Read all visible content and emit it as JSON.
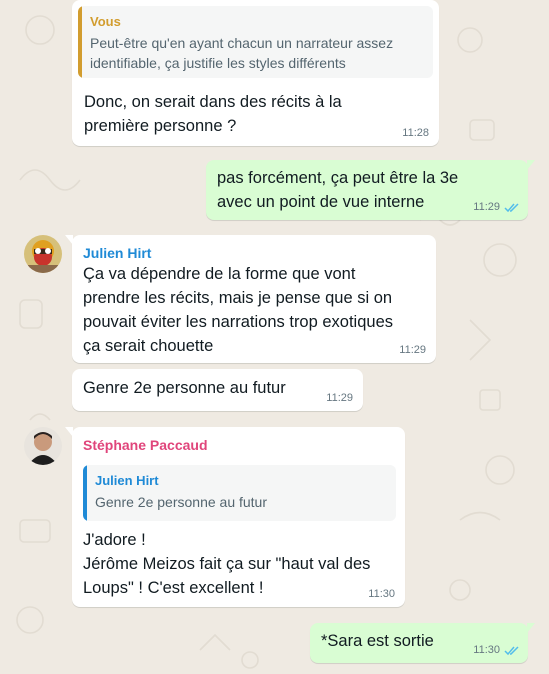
{
  "messages": [
    {
      "quote": {
        "sender": "Vous",
        "text": "Peut-être qu'en ayant chacun un narrateur assez\nidentifiable, ça justifie les styles différents",
        "color": "#d29d2f"
      },
      "text": "Donc, on serait dans des récits à la\npremière personne ?",
      "time": "11:28"
    },
    {
      "text": "pas forcément, ça peut être la 3e\navec un point de vue interne",
      "time": "11:29",
      "status": "double-check-icon"
    },
    {
      "sender": "Julien Hirt",
      "sender_color": "#1f8ad6",
      "text": "Ça va dépendre de la forme que vont\nprendre les récits, mais je pense que si on\npouvait éviter les narrations trop exotiques\nça serait chouette",
      "time": "11:29"
    },
    {
      "text": "Genre 2e personne au futur",
      "time": "11:29"
    },
    {
      "sender": "Stéphane Paccaud",
      "sender_color": "#e0457b",
      "quote": {
        "sender": "Julien Hirt",
        "text": "Genre 2e personne au futur",
        "color": "#1f8ad6"
      },
      "text": "J'adore !\nJérôme Meizos fait ça sur \"haut val des\nLoups\" ! C'est excellent !",
      "time": "11:30"
    },
    {
      "text": "*Sara est sortie",
      "time": "11:30",
      "status": "double-check-icon"
    }
  ],
  "colors": {
    "background": "#efeae2",
    "incoming": "#ffffff",
    "outgoing": "#d9fdd3",
    "read_ticks": "#53bdeb"
  }
}
